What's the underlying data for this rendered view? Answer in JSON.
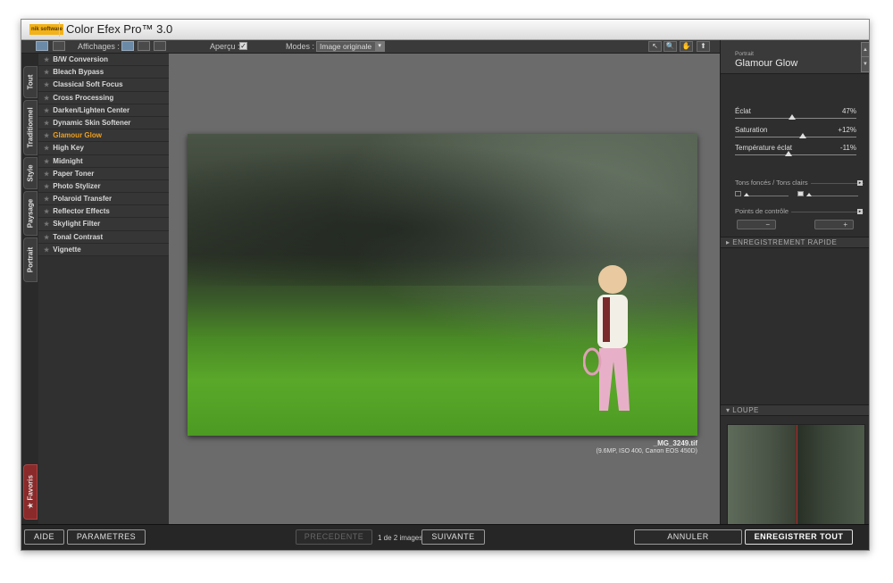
{
  "app": {
    "title": "Color Efex Pro™ 3.0",
    "logo": "nik software"
  },
  "toolbar": {
    "affichages_label": "Affichages :",
    "apercu_label": "Aperçu :",
    "apercu_checked": "✓",
    "modes_label": "Modes :",
    "modes_value": "Image originale",
    "modes_arrow": "▾",
    "tools": [
      "↖",
      "🔍",
      "✋",
      "⬆"
    ]
  },
  "tabs": [
    {
      "label": "Tout"
    },
    {
      "label": "Traditionnel"
    },
    {
      "label": "Style"
    },
    {
      "label": "Paysage"
    },
    {
      "label": "Portrait"
    },
    {
      "label": "★ Favoris"
    }
  ],
  "filters": [
    {
      "label": "B/W Conversion"
    },
    {
      "label": "Bleach Bypass"
    },
    {
      "label": "Classical Soft Focus"
    },
    {
      "label": "Cross Processing"
    },
    {
      "label": "Darken/Lighten Center"
    },
    {
      "label": "Dynamic Skin Softener"
    },
    {
      "label": "Glamour Glow"
    },
    {
      "label": "High Key"
    },
    {
      "label": "Midnight"
    },
    {
      "label": "Paper Toner"
    },
    {
      "label": "Photo Stylizer"
    },
    {
      "label": "Polaroid Transfer"
    },
    {
      "label": "Reflector Effects"
    },
    {
      "label": "Skylight Filter"
    },
    {
      "label": "Tonal Contrast"
    },
    {
      "label": "Vignette"
    }
  ],
  "star": "★",
  "preview": {
    "filename": "_MG_3249.tif",
    "meta": "(9.6MP, ISO 400, Canon EOS 450D)"
  },
  "panel": {
    "category": "Portrait",
    "filter": "Glamour Glow",
    "sliders": [
      {
        "label": "Éclat",
        "value": "47%",
        "level": 47
      },
      {
        "label": "Saturation",
        "value": "+12%",
        "level": 56
      },
      {
        "label": "Température éclat",
        "value": "-11%",
        "level": 44
      }
    ],
    "tones_label": "Tons foncés / Tons clairs",
    "control_points_label": "Points de contrôle",
    "cp_minus": "−",
    "cp_plus": "+",
    "quick_save": "ENREGISTREMENT RAPIDE",
    "loupe": "LOUPE"
  },
  "bottom": {
    "help": "AIDE",
    "settings": "PARAMETRES",
    "prev": "PRECEDENTE",
    "page": "1 de 2 images",
    "next": "SUIVANTE",
    "cancel": "ANNULER",
    "save_all": "ENREGISTRER TOUT"
  }
}
